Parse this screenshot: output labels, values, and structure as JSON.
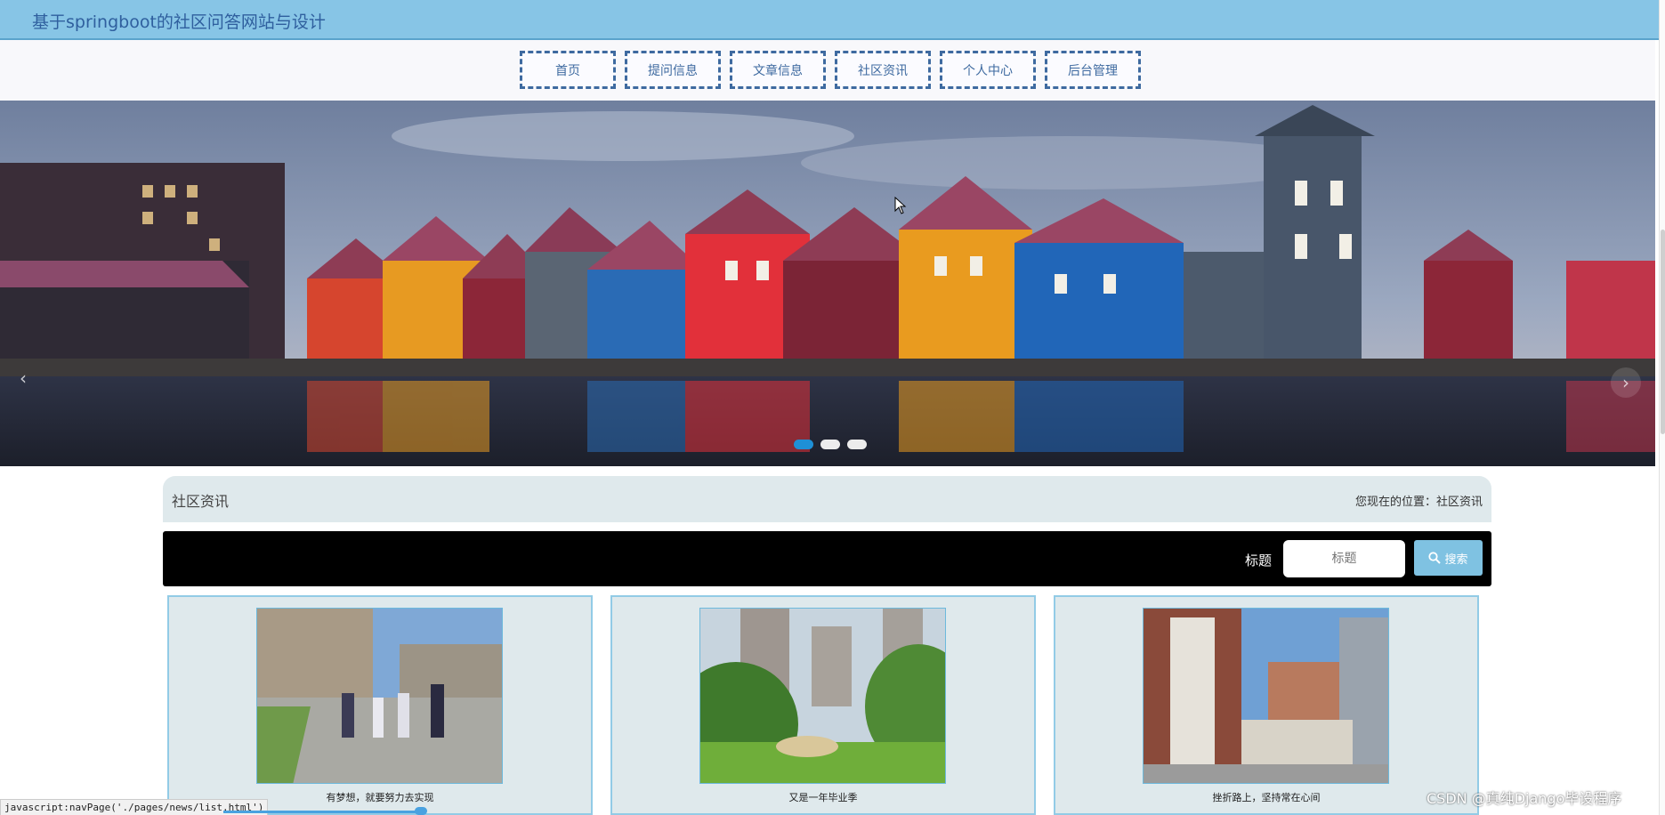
{
  "header": {
    "site_title": "基于springboot的社区问答网站与设计"
  },
  "nav": {
    "items": [
      {
        "label": "首页"
      },
      {
        "label": "提问信息"
      },
      {
        "label": "文章信息"
      },
      {
        "label": "社区资讯"
      },
      {
        "label": "个人中心"
      },
      {
        "label": "后台管理"
      }
    ]
  },
  "banner": {
    "arrow_left": "‹",
    "arrow_right": "›",
    "active_slide": 1,
    "slide_count": 3
  },
  "section": {
    "title": "社区资讯",
    "breadcrumb_prefix": "您现在的位置：",
    "breadcrumb_current": "社区资讯"
  },
  "search": {
    "label": "标题",
    "placeholder": "标题",
    "button_label": "搜索"
  },
  "cards": [
    {
      "caption": "有梦想，就要努力去实现"
    },
    {
      "caption": "又是一年毕业季"
    },
    {
      "caption": "挫折路上，坚持常在心间"
    }
  ],
  "statusbar": {
    "url": "javascript:navPage('./pages/news/list.html')"
  },
  "watermark": "CSDN @真纯Django毕设程序",
  "colors": {
    "topbar": "#87c5e6",
    "nav_border": "#3e6aa0",
    "search_button": "#7fc2e2",
    "card_bg": "#dfe9ec"
  }
}
